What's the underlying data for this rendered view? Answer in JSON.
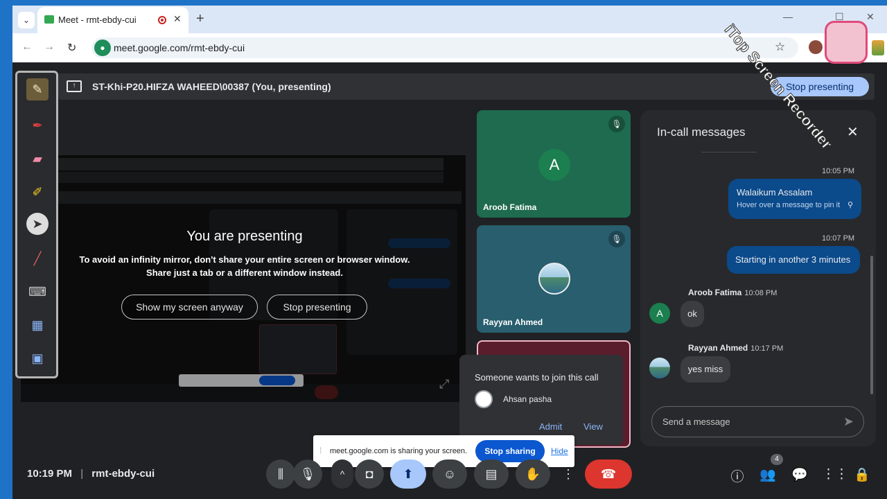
{
  "browser": {
    "tab_title": "Meet - rmt-ebdy-cui",
    "url": "meet.google.com/rmt-ebdy-cui",
    "new_tab": "+",
    "tab_close": "✕"
  },
  "present_bar": {
    "text": "ST-Khi-P20.HIFZA WAHEED\\00387 (You, presenting)",
    "stop_button": "Stop presenting"
  },
  "presenting": {
    "title": "You are presenting",
    "warning_line1": "To avoid an infinity mirror, don't share your entire screen or browser window.",
    "warning_line2": "Share just a tab or a different window instead.",
    "show_anyway": "Show my screen anyway",
    "stop": "Stop presenting"
  },
  "participants": [
    {
      "name": "Aroob Fatima",
      "initial": "A",
      "muted": true
    },
    {
      "name": "Rayyan Ahmed",
      "muted": true
    }
  ],
  "join_request": {
    "title": "Someone wants to join this call",
    "name": "Ahsan pasha",
    "admit": "Admit",
    "view": "View"
  },
  "chat": {
    "title": "In-call messages",
    "messages": [
      {
        "time": "10:05 PM",
        "text": "Walaikum Assalam",
        "hint": "Hover over a message to pin it"
      },
      {
        "time": "10:07 PM",
        "text": "Starting in another 3 minutes"
      },
      {
        "sender": "Aroob Fatima",
        "time": "10:08 PM",
        "text": "ok",
        "initial": "A"
      },
      {
        "sender": "Rayyan Ahmed",
        "time": "10:17 PM",
        "text": "yes miss"
      }
    ],
    "placeholder": "Send a message"
  },
  "share_bar": {
    "text": "meet.google.com is sharing your screen.",
    "stop": "Stop sharing",
    "hide": "Hide"
  },
  "bottom": {
    "time": "10:19 PM",
    "code": "rmt-ebdy-cui",
    "people_count": "4"
  },
  "colors": {
    "accent": "#a8c7fa",
    "end_call": "#dc362e",
    "tile_green": "#1f6b4f",
    "tile_teal": "#285e6e",
    "bubble": "#0b4a8b"
  },
  "watermark": "iTop Screen Recorder"
}
